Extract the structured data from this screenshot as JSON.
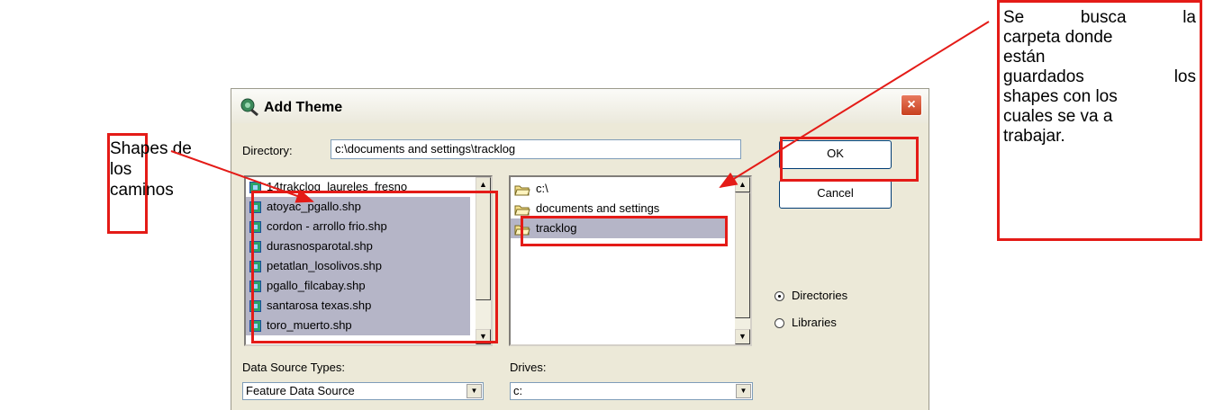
{
  "dialog": {
    "title": "Add Theme",
    "close_label": "×",
    "directory_label": "Directory:",
    "directory_value": "c:\\documents and settings\\tracklog",
    "files": [
      "14trakclog_laureles_fresno",
      "atoyac_pgallo.shp",
      "cordon - arrollo frio.shp",
      "durasnosparotal.shp",
      "petatlan_losolivos.shp",
      "pgallo_filcabay.shp",
      "santarosa texas.shp",
      "toro_muerto.shp"
    ],
    "folders": [
      "c:\\",
      "documents and settings",
      "tracklog"
    ],
    "ok_label": "OK",
    "cancel_label": "Cancel",
    "radio_directories": "Directories",
    "radio_libraries": "Libraries",
    "data_source_label": "Data Source Types:",
    "data_source_value": "Feature Data Source",
    "drives_label": "Drives:",
    "drives_value": "c:"
  },
  "annotations": {
    "left_note": [
      "Shapes de",
      "los",
      "caminos"
    ],
    "right_note": [
      "Se busca la",
      "carpeta donde",
      "están",
      "guardados los",
      "shapes con los",
      "cuales se va a",
      "trabajar."
    ]
  },
  "colors": {
    "annotation_red": "#e41b17",
    "dialog_bg": "#ece9d8"
  }
}
